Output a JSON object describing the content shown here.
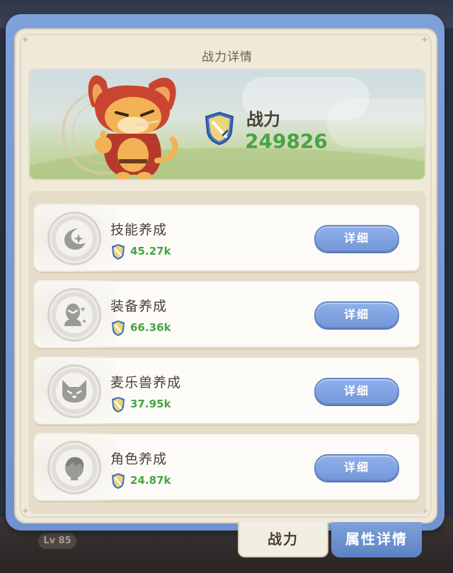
{
  "header": {
    "title": "战力详情"
  },
  "hero": {
    "label": "战力",
    "value": "249826"
  },
  "cards": [
    {
      "title": "技能养成",
      "value": "45.27k",
      "button": "详细",
      "icon": "moon-star-icon"
    },
    {
      "title": "装备养成",
      "value": "66.36k",
      "button": "详细",
      "icon": "alien-head-icon"
    },
    {
      "title": "麦乐兽养成",
      "value": "37.95k",
      "button": "详细",
      "icon": "cat-face-icon"
    },
    {
      "title": "角色养成",
      "value": "24.87k",
      "button": "详细",
      "icon": "character-head-icon"
    }
  ],
  "tabs": [
    {
      "label": "战力",
      "active": true
    },
    {
      "label": "属性详情",
      "active": false
    }
  ],
  "player": {
    "level": "Lv 85"
  },
  "colors": {
    "frame_blue": "#7fa1da",
    "panel_cream": "#efe9da",
    "value_green": "#4aa343",
    "button_blue": "#7598d9",
    "text_brown": "#4a4038"
  }
}
